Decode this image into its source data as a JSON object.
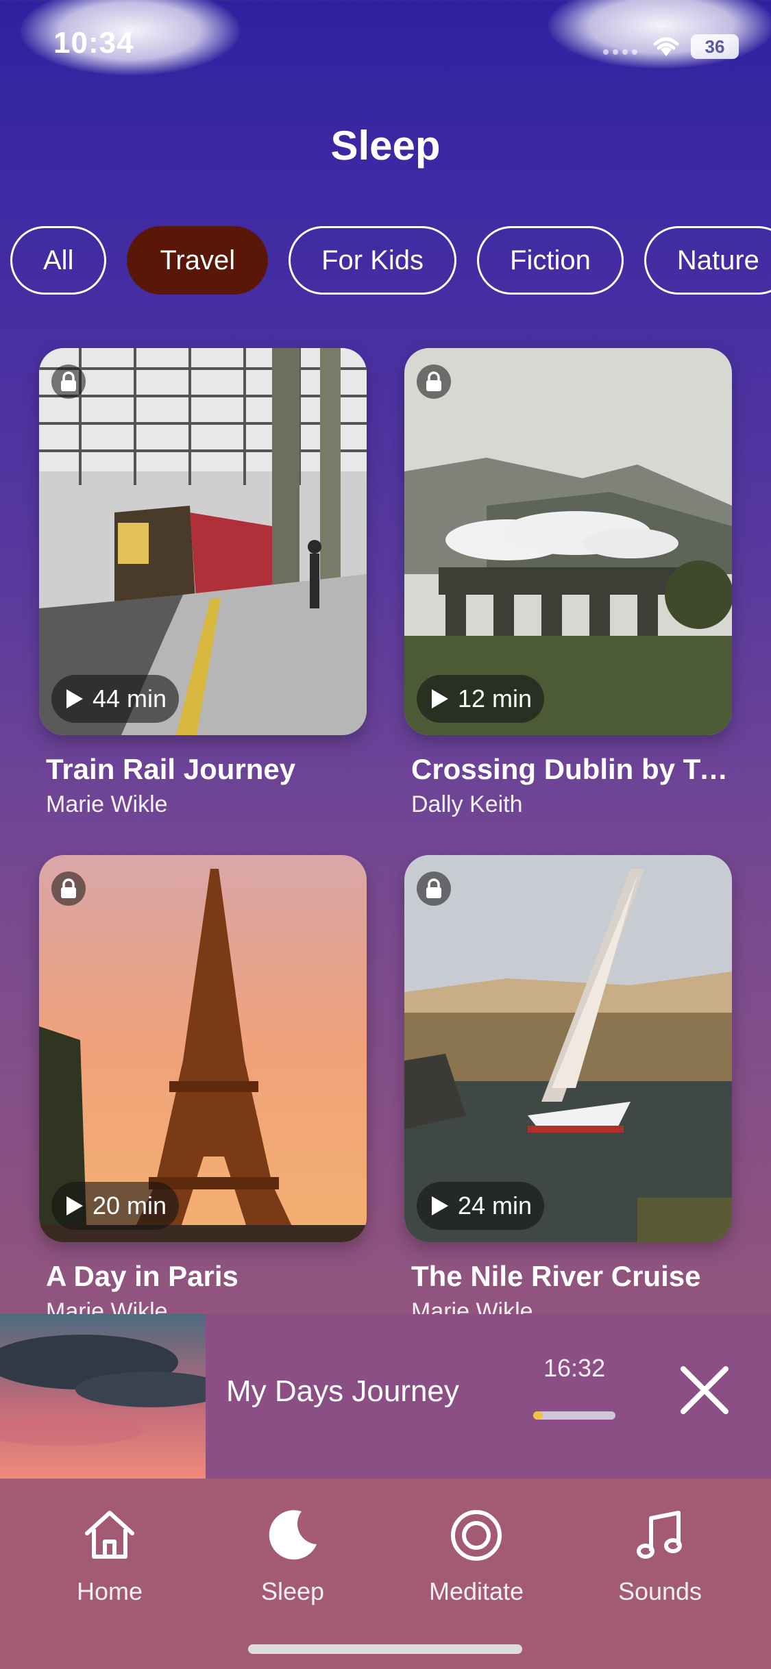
{
  "status_bar": {
    "time": "10:34",
    "battery": "36"
  },
  "page": {
    "title": "Sleep"
  },
  "categories": [
    {
      "label": "All",
      "selected": false
    },
    {
      "label": "Travel",
      "selected": true
    },
    {
      "label": "For Kids",
      "selected": false
    },
    {
      "label": "Fiction",
      "selected": false
    },
    {
      "label": "Nature",
      "selected": false
    }
  ],
  "stories": [
    {
      "title": "Train Rail Journey",
      "author": "Marie Wikle",
      "duration": "44 min",
      "locked": true
    },
    {
      "title": "Crossing Dublin by Train",
      "author": "Dally Keith",
      "duration": "12 min",
      "locked": true
    },
    {
      "title": "A Day in Paris",
      "author": "Marie Wikle",
      "duration": "20 min",
      "locked": true
    },
    {
      "title": "The Nile River Cruise",
      "author": "Marie Wikle",
      "duration": "24 min",
      "locked": true
    }
  ],
  "now_playing": {
    "title": "My Days Journey",
    "time": "16:32",
    "progress": 0.12
  },
  "tab_bar": {
    "items": [
      {
        "label": "Home",
        "icon": "home-icon",
        "active": false
      },
      {
        "label": "Sleep",
        "icon": "moon-icon",
        "active": true
      },
      {
        "label": "Meditate",
        "icon": "target-icon",
        "active": false
      },
      {
        "label": "Sounds",
        "icon": "music-note-icon",
        "active": false
      }
    ]
  },
  "colors": {
    "selected_chip": "#5a1606",
    "progress_fill": "#f2c04c",
    "player_bg": "#8b4f86",
    "tabbar_bg": "#a35a73"
  }
}
